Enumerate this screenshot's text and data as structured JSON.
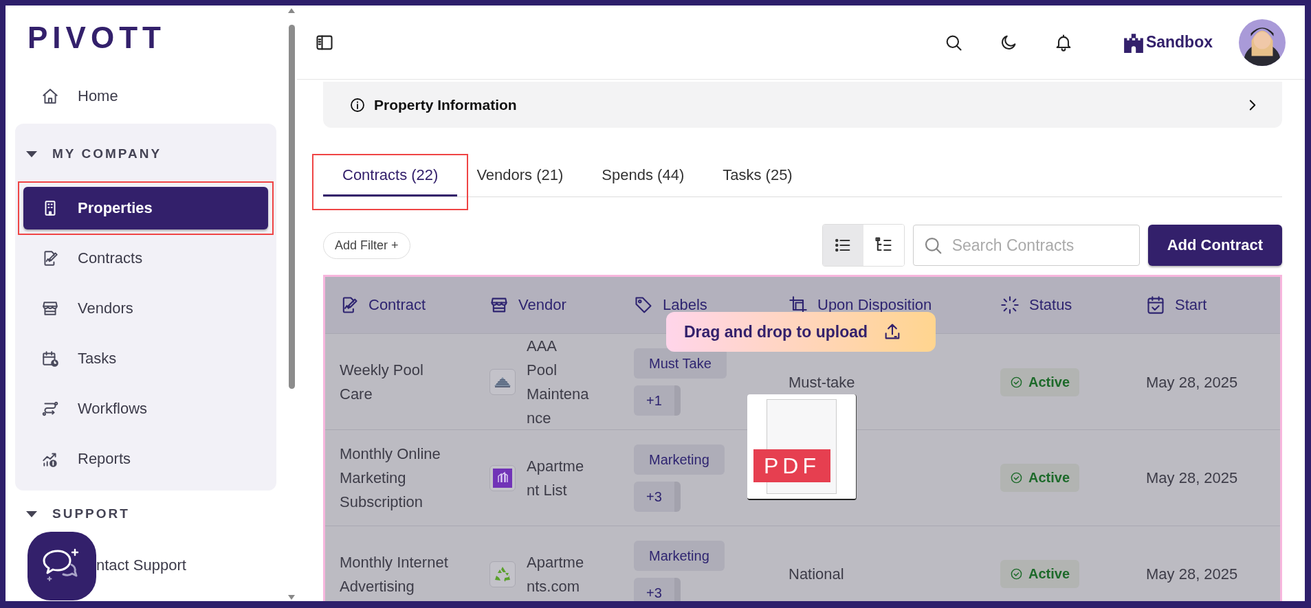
{
  "logo": "PIVOTT",
  "sidebar": {
    "items": [
      {
        "label": "Home",
        "selected": false,
        "annotated": false
      }
    ],
    "groups": [
      {
        "title": "MY COMPANY",
        "expanded": true,
        "boxed": true,
        "items": [
          {
            "label": "Properties",
            "selected": true,
            "annotated": true
          },
          {
            "label": "Contracts",
            "selected": false,
            "annotated": false
          },
          {
            "label": "Vendors",
            "selected": false,
            "annotated": false
          },
          {
            "label": "Tasks",
            "selected": false,
            "annotated": false
          },
          {
            "label": "Workflows",
            "selected": false,
            "annotated": false
          },
          {
            "label": "Reports",
            "selected": false,
            "annotated": false
          }
        ]
      },
      {
        "title": "SUPPORT",
        "expanded": true,
        "boxed": false,
        "items": [
          {
            "label": "ntact Support",
            "selected": false,
            "annotated": false
          }
        ]
      }
    ]
  },
  "header": {
    "workspace": "Sandbox"
  },
  "property_panel": {
    "title": "Property Information",
    "expanded": false
  },
  "tabs": [
    {
      "label": "Contracts (22)",
      "selected": true,
      "annotated": true
    },
    {
      "label": "Vendors (21)",
      "selected": false,
      "annotated": false
    },
    {
      "label": "Spends (44)",
      "selected": false,
      "annotated": false
    },
    {
      "label": "Tasks (25)",
      "selected": false,
      "annotated": false
    }
  ],
  "toolbar": {
    "filter": "Add Filter +",
    "views": [
      {
        "kind": "list",
        "selected": true
      },
      {
        "kind": "tree",
        "selected": false
      }
    ],
    "search": {
      "placeholder": "Search Contracts"
    },
    "add_button": "Add Contract"
  },
  "table": {
    "columns": [
      {
        "label": "Contract"
      },
      {
        "label": "Vendor"
      },
      {
        "label": "Labels"
      },
      {
        "label": "Upon Disposition"
      },
      {
        "label": "Status"
      },
      {
        "label": "Start"
      }
    ],
    "rows": [
      {
        "contract": "Weekly Pool Care",
        "vendor": "AAA Pool Maintenance",
        "labels": [
          "Must Take",
          "+1"
        ],
        "disposition": "Must-take",
        "status": {
          "label": "Active",
          "kind": "active"
        },
        "start": "May 28, 2025"
      },
      {
        "contract": "Monthly Online Marketing Subscription",
        "vendor": "Apartment List",
        "labels": [
          "Marketing",
          "+3"
        ],
        "status": {
          "label": "Active",
          "kind": "active"
        },
        "start": "May 28, 2025"
      },
      {
        "contract": "Monthly Internet Advertising",
        "vendor": "Apartments.com",
        "labels": [
          "Marketing",
          "+3"
        ],
        "disposition": "National",
        "status": {
          "label": "Active",
          "kind": "active"
        },
        "start": "May 28, 2025"
      }
    ]
  },
  "drop_overlay": {
    "active": true,
    "message": "Drag and drop to upload",
    "file_label": "PDF"
  }
}
